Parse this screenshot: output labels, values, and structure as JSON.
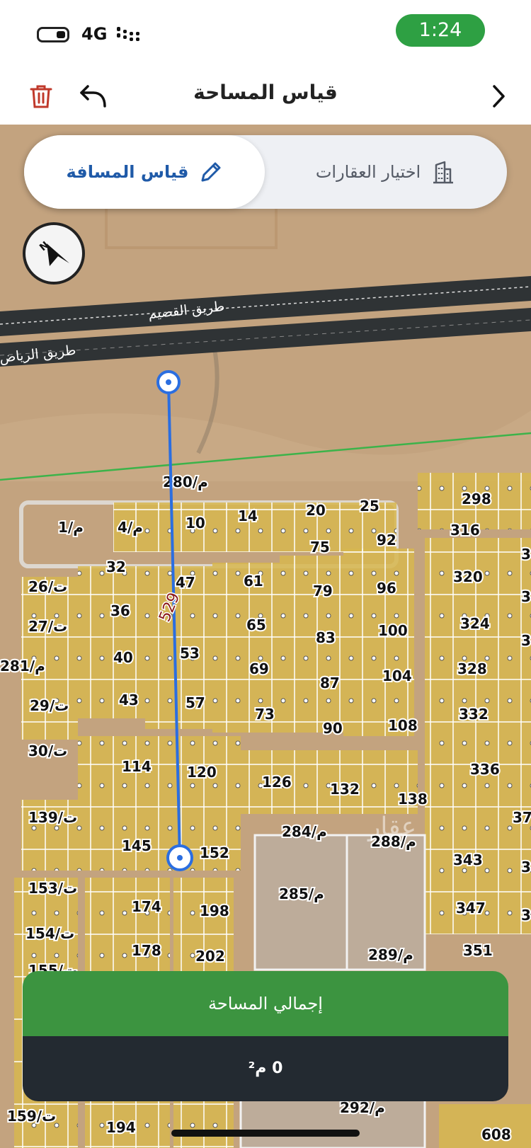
{
  "status": {
    "network": "4G",
    "time": "1:24"
  },
  "header": {
    "title": "قياس المساحة"
  },
  "mode_toggle": {
    "measure_distance": "قياس المسافة",
    "select_properties": "اختيار العقارات",
    "active": "measure_distance"
  },
  "map": {
    "roads": [
      "طريق القصيم",
      "طريق الرياض"
    ],
    "distance_label": "529",
    "watermark": "عقار",
    "lot_labels": [
      "280/م",
      "4/م",
      "1/م",
      "10",
      "14",
      "20",
      "25",
      "298",
      "316",
      "75",
      "92",
      "32",
      "26/ت",
      "47",
      "61",
      "79",
      "96",
      "320",
      "36",
      "27/ت",
      "65",
      "83",
      "100",
      "324",
      "40",
      "281/م",
      "53",
      "69",
      "87",
      "104",
      "328",
      "29/ت",
      "43",
      "57",
      "73",
      "90",
      "108",
      "332",
      "30/ت",
      "114",
      "120",
      "126",
      "132",
      "138",
      "336",
      "139/ت",
      "145",
      "152",
      "284/م",
      "288/م",
      "343",
      "153/ت",
      "174",
      "198",
      "285/م",
      "347",
      "154/ت",
      "178",
      "202",
      "289/م",
      "351",
      "155/ت",
      "159/ت",
      "194",
      "292/م",
      "608",
      "3",
      "3",
      "3",
      "37",
      "3",
      "3"
    ]
  },
  "summary": {
    "label": "إجمالي المساحة",
    "value": "0 م²"
  },
  "colors": {
    "accent": "#2ea043",
    "primary": "#1f5aa8",
    "panel_dark": "#232a31",
    "panel_green": "#3c9440",
    "delete": "#c0392b"
  }
}
